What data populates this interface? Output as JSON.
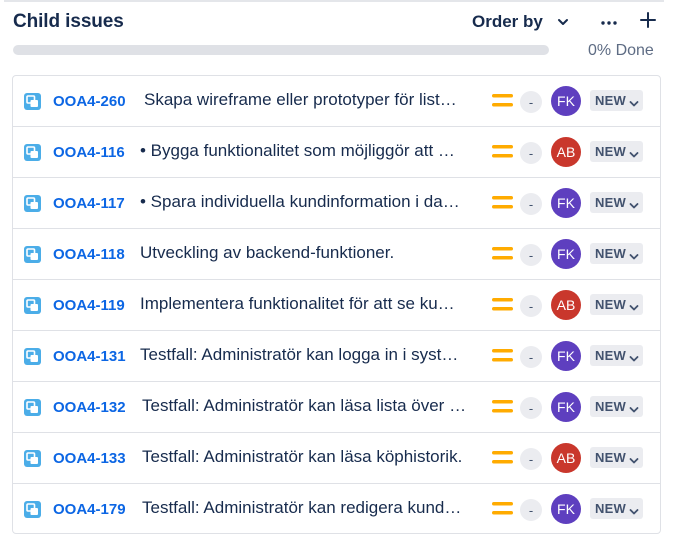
{
  "header": {
    "title": "Child issues",
    "order_by_label": "Order by"
  },
  "progress": {
    "percent": 0,
    "label": "0% Done",
    "fill_color": "#22a06b"
  },
  "colors": {
    "key_link": "#0c66e4",
    "priority_medium": "#ffab00",
    "status_bg": "#ebecf0"
  },
  "issues": [
    {
      "key": "OOA4-260",
      "summary": "Skapa wireframe eller prototyper för list…",
      "estimate": "-",
      "assignee": "FK",
      "assignee_color": "#5e3fbf",
      "status": "NEW",
      "priority": "medium-icon"
    },
    {
      "key": "OOA4-116",
      "summary": "• Bygga funktionalitet som möjliggör att …",
      "estimate": "-",
      "assignee": "AB",
      "assignee_color": "#c9372c",
      "status": "NEW",
      "priority": "medium-icon"
    },
    {
      "key": "OOA4-117",
      "summary": "• Spara individuella kundinformation i da…",
      "estimate": "-",
      "assignee": "FK",
      "assignee_color": "#5e3fbf",
      "status": "NEW",
      "priority": "medium-icon"
    },
    {
      "key": "OOA4-118",
      "summary": "Utveckling av backend-funktioner.",
      "estimate": "-",
      "assignee": "FK",
      "assignee_color": "#5e3fbf",
      "status": "NEW",
      "priority": "medium-icon"
    },
    {
      "key": "OOA4-119",
      "summary": "Implementera funktionalitet för att se ku…",
      "estimate": "-",
      "assignee": "AB",
      "assignee_color": "#c9372c",
      "status": "NEW",
      "priority": "medium-icon"
    },
    {
      "key": "OOA4-131",
      "summary": "Testfall: Administratör kan logga in i syst…",
      "estimate": "-",
      "assignee": "FK",
      "assignee_color": "#5e3fbf",
      "status": "NEW",
      "priority": "medium-icon"
    },
    {
      "key": "OOA4-132",
      "summary": "Testfall: Administratör kan läsa lista över …",
      "estimate": "-",
      "assignee": "FK",
      "assignee_color": "#5e3fbf",
      "status": "NEW",
      "priority": "medium-icon"
    },
    {
      "key": "OOA4-133",
      "summary": "Testfall: Administratör kan läsa köphistorik.",
      "estimate": "-",
      "assignee": "AB",
      "assignee_color": "#c9372c",
      "status": "NEW",
      "priority": "medium-icon"
    },
    {
      "key": "OOA4-179",
      "summary": "Testfall: Administratör kan redigera kund…",
      "estimate": "-",
      "assignee": "FK",
      "assignee_color": "#5e3fbf",
      "status": "NEW",
      "priority": "medium-icon"
    }
  ]
}
